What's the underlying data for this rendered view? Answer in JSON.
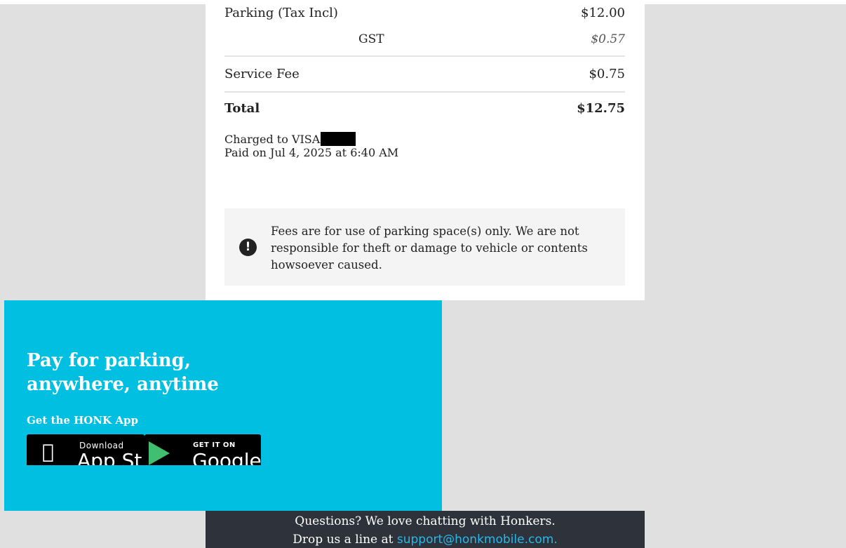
{
  "receipt": {
    "parking": {
      "label": "Parking (Tax Incl)",
      "amount": "$12.00"
    },
    "gst": {
      "label": "GST",
      "amount": "$0.57"
    },
    "service_fee": {
      "label": "Service Fee",
      "amount": "$0.75"
    },
    "total": {
      "label": "Total",
      "amount": "$12.75"
    },
    "charged_to": "Charged to VISA",
    "paid_on": "Paid on Jul 4, 2025 at 6:40 AM"
  },
  "notice": {
    "icon": "exclamation-icon",
    "text": "Fees are for use of parking space(s) only. We are not responsible for theft or damage to vehicle or contents howsoever caused."
  },
  "promo": {
    "title_line1": "Pay for parking,",
    "title_line2": "anywhere, anytime",
    "subtitle": "Get the HONK App",
    "app_store": {
      "small": "Download",
      "big": "App St"
    },
    "google_play": {
      "small": "GET IT ON",
      "big": "Google"
    }
  },
  "support": {
    "line1": "Questions? We love chatting with Honkers.",
    "line2_prefix": "Drop us a line at ",
    "email": "support@honkmobile.com."
  },
  "colors": {
    "promo_bg": "#00bfe0",
    "footer_bg": "#2e333b",
    "link": "#29b8ea"
  }
}
